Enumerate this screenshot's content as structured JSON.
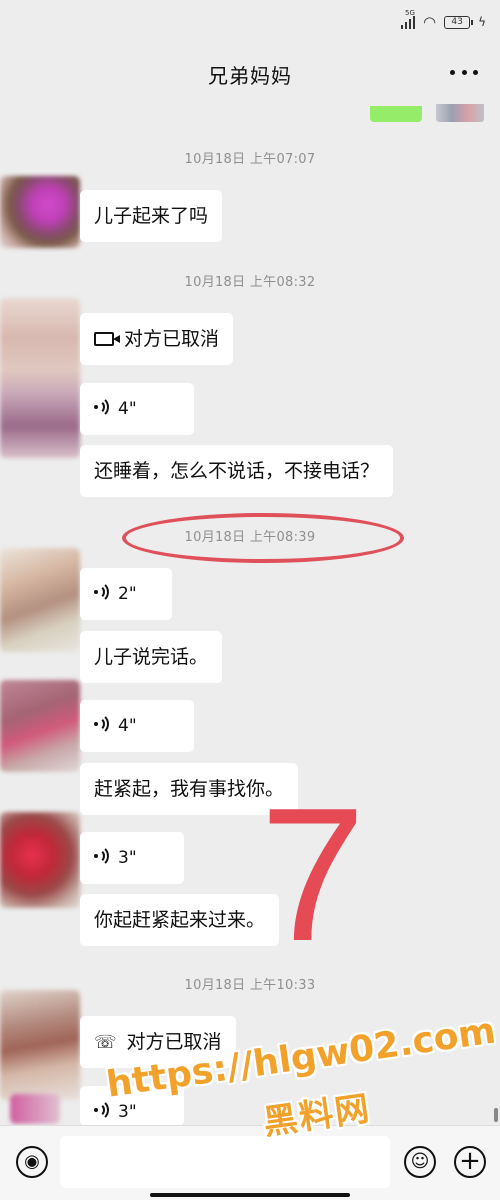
{
  "status_bar": {
    "network": "5G",
    "battery": "43"
  },
  "header": {
    "title": "兄弟妈妈"
  },
  "messages": [
    {
      "time": "10月18日 上午07:07"
    },
    {
      "text": "儿子起来了吗"
    },
    {
      "time": "10月18日 上午08:32"
    },
    {
      "video_call_text": "对方已取消"
    },
    {
      "voice_duration": "4\""
    },
    {
      "text": "还睡着，怎么不说话，不接电话？"
    },
    {
      "time": "10月18日 上午08:39"
    },
    {
      "voice_duration": "2\""
    },
    {
      "text": "儿子说完话。"
    },
    {
      "voice_duration": "4\""
    },
    {
      "text": "赶紧起，我有事找你。"
    },
    {
      "voice_duration": "3\""
    },
    {
      "text": "你起赶紧起来过来。"
    },
    {
      "time": "10月18日 上午10:33"
    },
    {
      "voice_call_text": "对方已取消"
    },
    {
      "voice_duration": "3\""
    }
  ],
  "annotation": {
    "number": "7",
    "highlight_color": "#e0505a"
  },
  "watermark": {
    "url": "https://hlgw02.com",
    "name": "黑料网",
    "color": "#f2a12b"
  },
  "icons": {
    "voice_input": "voice-input-icon",
    "emoji": "emoji-icon",
    "plus": "plus-icon",
    "more": "more-icon"
  }
}
